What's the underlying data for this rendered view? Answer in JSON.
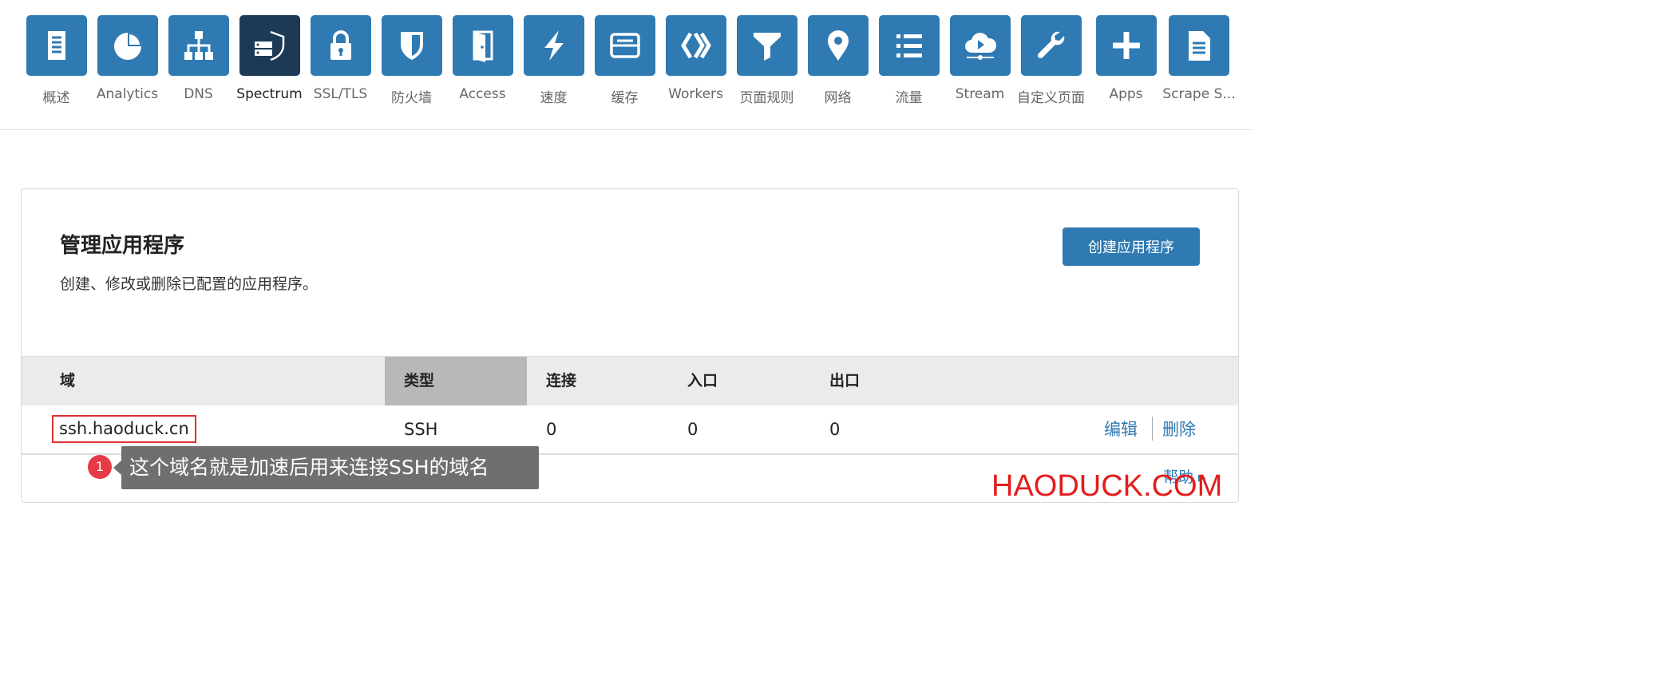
{
  "nav": {
    "items": [
      {
        "label": "概述",
        "icon": "document-icon"
      },
      {
        "label": "Analytics",
        "icon": "pie-chart-icon"
      },
      {
        "label": "DNS",
        "icon": "network-tree-icon"
      },
      {
        "label": "Spectrum",
        "icon": "server-shield-icon",
        "active": true
      },
      {
        "label": "SSL/TLS",
        "icon": "lock-icon"
      },
      {
        "label": "防火墙",
        "icon": "shield-icon"
      },
      {
        "label": "Access",
        "icon": "door-icon"
      },
      {
        "label": "速度",
        "icon": "lightning-icon"
      },
      {
        "label": "缓存",
        "icon": "storage-icon"
      },
      {
        "label": "Workers",
        "icon": "workers-icon"
      },
      {
        "label": "页面规则",
        "icon": "filter-icon"
      },
      {
        "label": "网络",
        "icon": "location-pin-icon"
      },
      {
        "label": "流量",
        "icon": "list-icon"
      },
      {
        "label": "Stream",
        "icon": "cloud-play-icon"
      },
      {
        "label": "自定义页面",
        "icon": "wrench-icon"
      },
      {
        "label": "Apps",
        "icon": "plus-icon"
      },
      {
        "label": "Scrape S...",
        "icon": "page-icon"
      }
    ]
  },
  "card": {
    "title": "管理应用程序",
    "description": "创建、修改或删除已配置的应用程序。",
    "create_button": "创建应用程序",
    "columns": {
      "domain": "域",
      "type": "类型",
      "connections": "连接",
      "ingress": "入口",
      "egress": "出口"
    },
    "rows": [
      {
        "domain": "ssh.haoduck.cn",
        "type": "SSH",
        "connections": "0",
        "ingress": "0",
        "egress": "0"
      }
    ],
    "actions": {
      "edit": "编辑",
      "delete": "删除"
    },
    "help": "帮助 ▸"
  },
  "annotation": {
    "badge": "1",
    "text": "这个域名就是加速后用来连接SSH的域名"
  },
  "watermark": "HAODUCK.COM",
  "colors": {
    "accent": "#2f7ab2",
    "active_nav": "#1c3a56",
    "highlight_border": "#dd3333",
    "badge": "#e63a46",
    "watermark": "#e51c1c"
  }
}
